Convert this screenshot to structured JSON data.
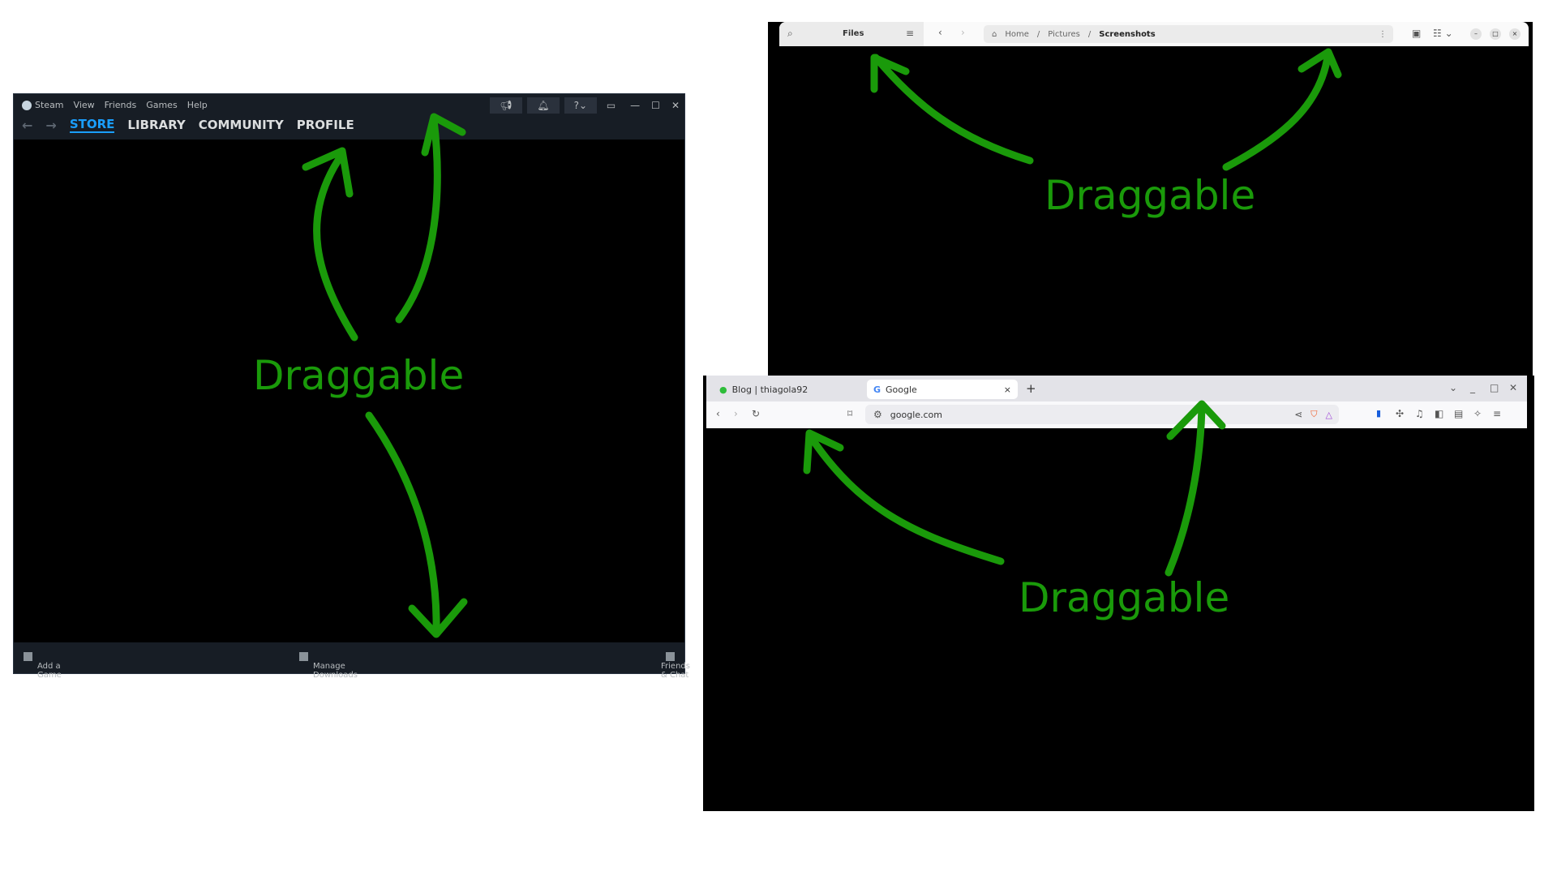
{
  "steam": {
    "menu": [
      "Steam",
      "View",
      "Friends",
      "Games",
      "Help"
    ],
    "nav": [
      "STORE",
      "LIBRARY",
      "COMMUNITY",
      "PROFILE"
    ],
    "help": "?",
    "footer": {
      "add_game": "Add a Game",
      "downloads": "Manage Downloads",
      "friends": "Friends & Chat"
    }
  },
  "files": {
    "title": "Files",
    "breadcrumb": [
      "Home",
      "Pictures",
      "Screenshots"
    ]
  },
  "browser": {
    "tabs": [
      {
        "title": "Blog | thiagola92"
      },
      {
        "title": "Google"
      }
    ],
    "new_tab": "+",
    "url": "google.com"
  },
  "annotations": {
    "label": "Draggable",
    "color": "#1a9a0a"
  }
}
